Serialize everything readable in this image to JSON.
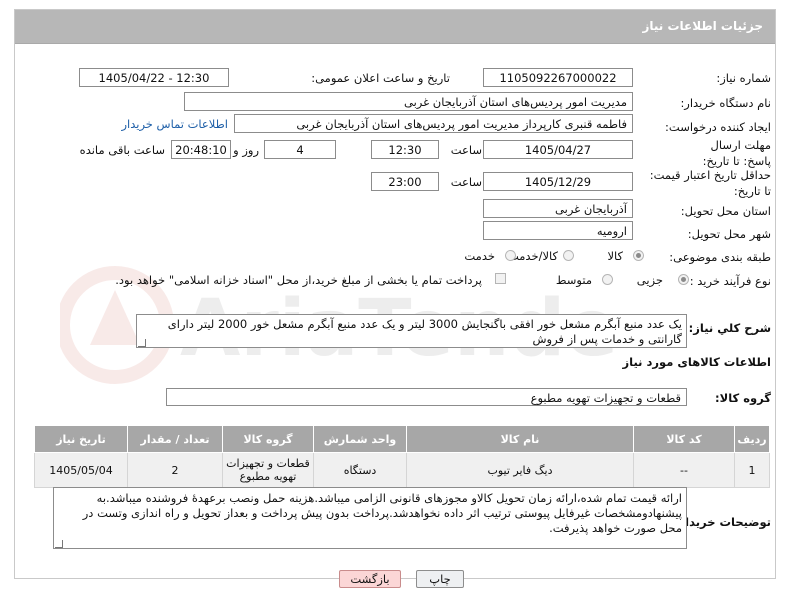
{
  "header": {
    "title": "جزئیات اطلاعات نیاز"
  },
  "form": {
    "need_number": {
      "label": "شماره نیاز:",
      "value": "1105092267000022"
    },
    "announce": {
      "label": "تاریخ و ساعت اعلان عمومی:",
      "value": "1405/04/22 - 12:30"
    },
    "buyer_org": {
      "label": "نام دستگاه خریدار:",
      "value": "مدیریت امور پردیس‌های استان آذربایجان غربی"
    },
    "creator": {
      "label": "ایجاد کننده درخواست:",
      "value": "فاطمه قنبری کارپرداز مدیریت امور پردیس‌های استان آذربایجان غربی",
      "contact_link": "اطلاعات تماس خریدار"
    },
    "deadline": {
      "label": "مهلت ارسال پاسخ: تا تاریخ:",
      "date": "1405/04/27",
      "time_label": "ساعت",
      "time": "12:30",
      "days": "4",
      "days_label": "روز و",
      "remaining": "20:48:10",
      "remaining_label": "ساعت باقی مانده"
    },
    "price_validity": {
      "label": "حداقل تاریخ اعتبار قیمت: تا تاریخ:",
      "date": "1405/12/29",
      "time_label": "ساعت",
      "time": "23:00"
    },
    "province": {
      "label": "استان محل تحویل:",
      "value": "آذربایجان غربی"
    },
    "city": {
      "label": "شهر محل تحویل:",
      "value": "ارومیه"
    },
    "category": {
      "label": "طبقه بندی موضوعی:",
      "options": [
        "کالا",
        "کالا/خدمت",
        "خدمت"
      ],
      "selected": "کالا"
    },
    "process": {
      "label": "نوع فرآیند خرید :",
      "options": [
        "جزیی",
        "متوسط"
      ],
      "selected": "جزیی",
      "payment_note": "پرداخت تمام یا بخشی از مبلغ خرید،از محل \"اسناد خزانه اسلامی\" خواهد بود."
    },
    "description": {
      "label": "شرح کلي نياز:",
      "value": "یک عدد منبع آبگرم مشعل خور افقی باگنجایش 3000 لیتر و یک عدد منبع آبگرم مشعل خور 2000 لیتر دارای گارانتی و خدمات پس از فروش"
    },
    "goods_info_title": "اطلاعات کالاهای مورد نیاز",
    "goods_group": {
      "label": "گروه کالا:",
      "value": "قطعات و تجهیزات تهویه مطبوع"
    }
  },
  "table": {
    "headers": [
      "ردیف",
      "کد کالا",
      "نام کالا",
      "واحد شمارش",
      "گروه کالا",
      "تعداد / مقدار",
      "تاریخ نیاز"
    ],
    "rows": [
      [
        "1",
        "--",
        "دیگ فایر تیوب",
        "دستگاه",
        "قطعات و تجهیزات تهویه مطبوع",
        "2",
        "1405/05/04"
      ]
    ]
  },
  "buyer_notes": {
    "label": "توضیحات خریدار:",
    "value": "ارائه قیمت تمام شده،ارائه زمان تحویل کالاو مجوزهای قانونی الزامی میباشد.هزینه حمل ونصب برعهدۀ فروشنده میباشد.به پیشنهادومشخصات غیرفایل پیوستی ترتیب اثر داده نخواهدشد.پرداخت بدون پیش پرداخت و بعداز تحویل و راه اندازی وتست در محل صورت خواهد پذیرفت."
  },
  "buttons": {
    "print": "چاپ",
    "back": "بازگشت"
  },
  "watermark_text": "AriaTender.net"
}
